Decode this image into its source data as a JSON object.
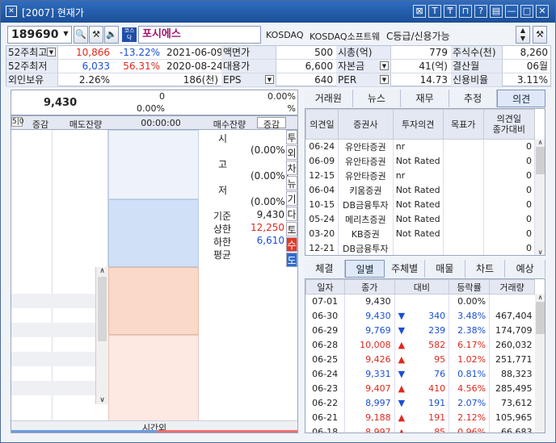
{
  "window": {
    "id": "[2007]",
    "title": "현재가",
    "buttons": [
      "⊠",
      "T",
      "₸",
      "⊓",
      "?",
      "▤",
      "—",
      "□",
      "✕"
    ]
  },
  "stock": {
    "code": "189690",
    "name": "포시에스",
    "market": "KOSDAQ",
    "sector": "KOSDAQ소프트웨",
    "grade": "C등급/신용가능"
  },
  "info": [
    [
      {
        "t": "52주최고",
        "dd": true
      },
      {
        "t": "10,866",
        "c": "red"
      },
      {
        "t": "-13.22%",
        "c": "blue"
      },
      {
        "t": "2021-06-09"
      },
      {
        "t": "액면가",
        "lab": true
      },
      {
        "t": "500"
      },
      {
        "t": "시총(억)",
        "lab": true
      },
      {
        "t": "779"
      },
      {
        "t": "주식수(천)",
        "lab": true
      },
      {
        "t": "8,260"
      }
    ],
    [
      {
        "t": "52주최저"
      },
      {
        "t": "6,033",
        "c": "blue"
      },
      {
        "t": "56.31%",
        "c": "red"
      },
      {
        "t": "2020-08-24"
      },
      {
        "t": "대용가",
        "lab": true
      },
      {
        "t": "6,600"
      },
      {
        "t": "자본금",
        "lab": true,
        "dd": true
      },
      {
        "t": "41(억)"
      },
      {
        "t": "결산월",
        "lab": true
      },
      {
        "t": "06월"
      }
    ],
    [
      {
        "t": "외인보유"
      },
      {
        "t": "2.26%"
      },
      {
        "t": ""
      },
      {
        "t": "186(천)"
      },
      {
        "t": "EPS",
        "lab": true,
        "dd": true
      },
      {
        "t": "640"
      },
      {
        "t": "PER",
        "lab": true,
        "dd": true
      },
      {
        "t": "14.73"
      },
      {
        "t": "신용비율",
        "lab": true
      },
      {
        "t": "3.11%"
      }
    ]
  ],
  "price_box": {
    "price": "9,430",
    "zero1": "0",
    "rate": "0.00%",
    "vol_pct": "0.00%",
    "pct_sign": "%"
  },
  "orderbook": {
    "hdr": [
      "증감",
      "매도잔량",
      "00:00:00",
      "매수잔량",
      "증감"
    ],
    "side_label": "5|0",
    "stats": {
      "si": "시",
      "go": "고",
      "jeo": "저",
      "si_pct": "(0.00%)",
      "go_pct": "(0.00%)",
      "jeo_pct": "(0.00%)",
      "base_l": "기준",
      "base_v": "9,430",
      "up_l": "상한",
      "up_v": "12,250",
      "dn_l": "하한",
      "dn_v": "6,610",
      "avg_l": "평균"
    },
    "vtabs": [
      "투",
      "외",
      "차",
      "뉴",
      "기",
      "다",
      "토",
      "수",
      "도"
    ],
    "footer": "시간외"
  },
  "tabs_top": [
    "거래원",
    "뉴스",
    "재무",
    "추정",
    "의견"
  ],
  "opinion": {
    "hdr": [
      "의견일",
      "증권사",
      "투자의견",
      "목표가",
      "의견일\n종가대비"
    ],
    "rows": [
      [
        "06-24",
        "유안타증권",
        "nr",
        "",
        "0"
      ],
      [
        "06-09",
        "유안타증권",
        "Not Rated",
        "",
        "0"
      ],
      [
        "12-15",
        "유안타증권",
        "nr",
        "",
        "0"
      ],
      [
        "06-04",
        "키움증권",
        "Not Rated",
        "",
        "0"
      ],
      [
        "10-15",
        "DB금융투자",
        "Not Rated",
        "",
        "0"
      ],
      [
        "05-24",
        "메리츠증권",
        "Not Rated",
        "",
        "0"
      ],
      [
        "03-20",
        "KB증권",
        "Not Rated",
        "",
        "0"
      ],
      [
        "12-21",
        "DB금융투자",
        "",
        "",
        "0"
      ]
    ]
  },
  "tabs_bottom": [
    "체결",
    "일별",
    "주체별",
    "매물",
    "차트",
    "예상"
  ],
  "daily": {
    "hdr": [
      "일자",
      "종가",
      "대비",
      "등락률",
      "거래량"
    ],
    "rows": [
      {
        "d": "07-01",
        "p": "9,430",
        "a": "",
        "v": "",
        "r": "0.00%",
        "q": "",
        "c": ""
      },
      {
        "d": "06-30",
        "p": "9,430",
        "a": "▼",
        "v": "340",
        "r": "3.48%",
        "q": "467,404",
        "c": "blue"
      },
      {
        "d": "06-29",
        "p": "9,769",
        "a": "▼",
        "v": "239",
        "r": "2.38%",
        "q": "174,709",
        "c": "blue"
      },
      {
        "d": "06-28",
        "p": "10,008",
        "a": "▲",
        "v": "582",
        "r": "6.17%",
        "q": "260,032",
        "c": "red"
      },
      {
        "d": "06-25",
        "p": "9,426",
        "a": "▲",
        "v": "95",
        "r": "1.02%",
        "q": "251,771",
        "c": "red"
      },
      {
        "d": "06-24",
        "p": "9,331",
        "a": "▼",
        "v": "76",
        "r": "0.81%",
        "q": "88,323",
        "c": "blue"
      },
      {
        "d": "06-23",
        "p": "9,407",
        "a": "▲",
        "v": "410",
        "r": "4.56%",
        "q": "285,495",
        "c": "red"
      },
      {
        "d": "06-22",
        "p": "8,997",
        "a": "▼",
        "v": "191",
        "r": "2.07%",
        "q": "73,612",
        "c": "blue"
      },
      {
        "d": "06-21",
        "p": "9,188",
        "a": "▲",
        "v": "191",
        "r": "2.12%",
        "q": "105,965",
        "c": "red"
      },
      {
        "d": "06-18",
        "p": "8,997",
        "a": "▲",
        "v": "85",
        "r": "0.96%",
        "q": "66,683",
        "c": "red"
      }
    ]
  }
}
